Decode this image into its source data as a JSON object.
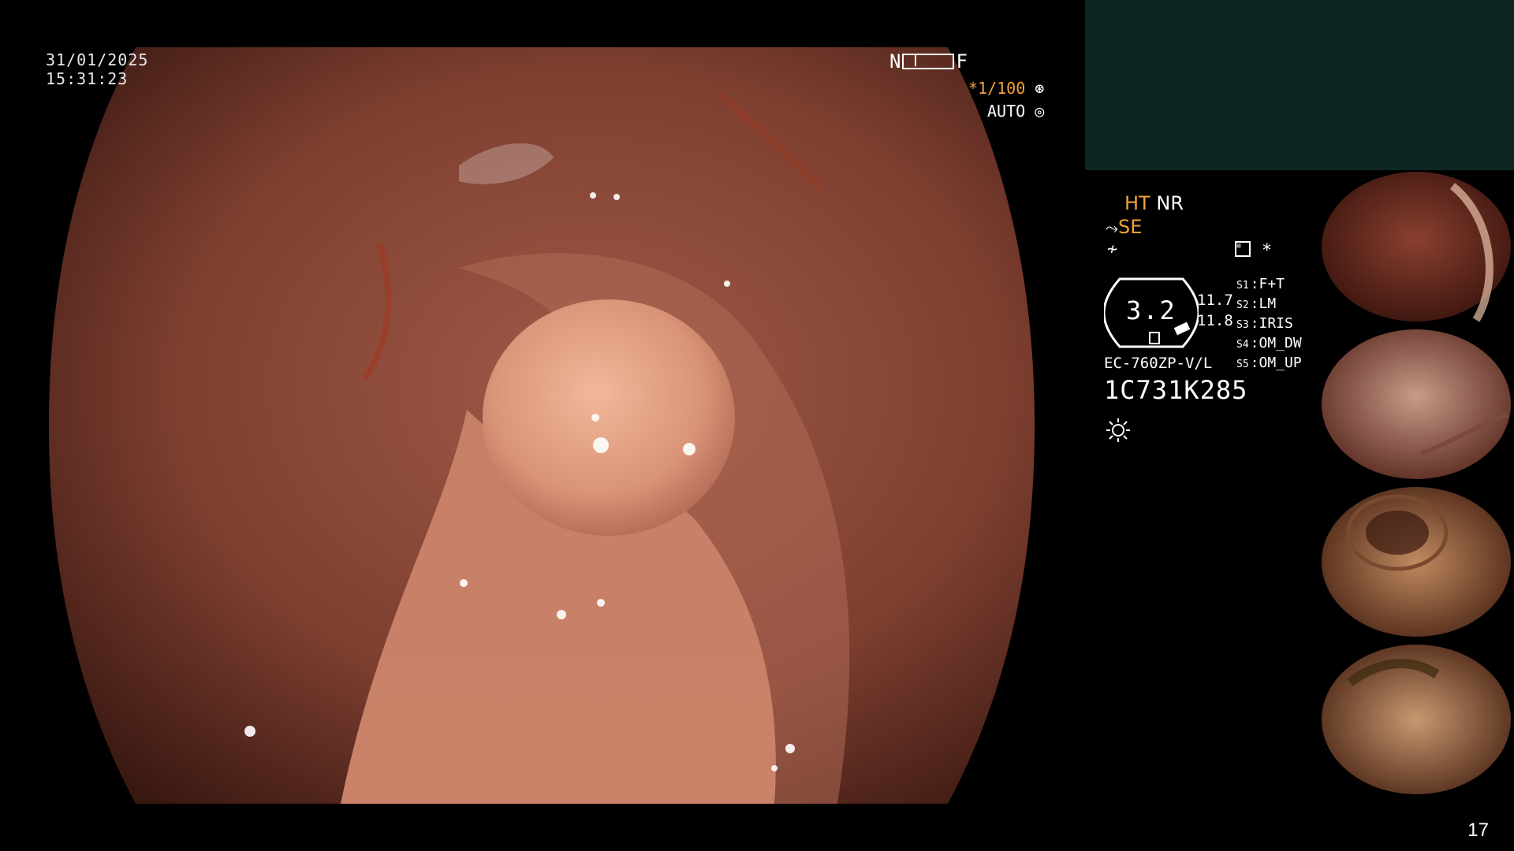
{
  "datetime": {
    "date": "31/01/2025",
    "time": "15:31:23"
  },
  "focus_bar": {
    "near_label": "N",
    "far_label": "F",
    "level": 0.2
  },
  "shutter": {
    "value": "*1/100",
    "icon": "shutter-icon"
  },
  "iris": {
    "value": "AUTO",
    "icon": "iris-icon"
  },
  "info": {
    "ht": "HT",
    "nr": "NR",
    "se": "SE",
    "se_icon": "enhancement-icon",
    "lf_icon": "lightning-icon",
    "scope_icon": "scope-icon",
    "star": "*",
    "gauge_value": "3.2",
    "gauge_small_1": "11.7",
    "gauge_small_2": "11.8",
    "switches": [
      {
        "key": "S1",
        "value": "F+T"
      },
      {
        "key": "S2",
        "value": "LM"
      },
      {
        "key": "S3",
        "value": "IRIS"
      },
      {
        "key": "S4",
        "value": "OM_DW"
      },
      {
        "key": "S5",
        "value": "OM_UP"
      }
    ],
    "model": "EC-760ZP-V/L",
    "serial": "1C731K285",
    "light_icon": "sun-icon"
  },
  "thumbnails": [
    {
      "name": "capture-1",
      "tone": "#8a4030"
    },
    {
      "name": "capture-2",
      "tone": "#b88270"
    },
    {
      "name": "capture-3",
      "tone": "#b07a50"
    },
    {
      "name": "capture-4",
      "tone": "#b58560"
    }
  ],
  "page_number": "17",
  "colors": {
    "accent": "#f2a23a",
    "panel": "#0d2624"
  }
}
